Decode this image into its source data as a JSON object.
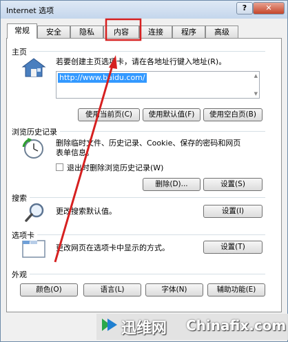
{
  "window": {
    "title": "Internet 选项",
    "help_label": "?",
    "close_label": "✕"
  },
  "tabs": [
    "常规",
    "安全",
    "隐私",
    "内容",
    "连接",
    "程序",
    "高级"
  ],
  "home": {
    "title": "主页",
    "desc": "若要创建主页选项卡，请在各地址行键入地址(R)。",
    "url": "http://www.baidu.com/",
    "buttons": [
      "使用当前页(C)",
      "使用默认值(F)",
      "使用空白页(B)"
    ]
  },
  "history": {
    "title": "浏览历史记录",
    "desc_line1": "删除临时文件、历史记录、Cookie、保存的密码和网页",
    "desc_line2": "表单信息。",
    "checkbox_label": "退出时删除浏览历史记录(W)",
    "buttons": [
      "删除(D)...",
      "设置(S)"
    ]
  },
  "search": {
    "title": "搜索",
    "desc": "更改搜索默认值。",
    "button": "设置(I)"
  },
  "tabsec": {
    "title": "选项卡",
    "desc": "更改网页在选项卡中显示的方式。",
    "button": "设置(T)"
  },
  "appearance": {
    "title": "外观",
    "buttons": [
      "颜色(O)",
      "语言(L)",
      "字体(N)",
      "辅助功能(E)"
    ]
  },
  "watermark": {
    "cn": "迅维网",
    "en": "Chinafix.com"
  },
  "colors": {
    "annotation_red": "#d62020",
    "selection_blue": "#3399ff",
    "title_bar": "#c4d6ec"
  },
  "icons": {
    "home": "house-icon",
    "history": "clock-with-green-arrow-icon",
    "search": "magnifier-icon",
    "tabs": "tabbed-windows-icon",
    "watermark": "site-logo-icon"
  }
}
